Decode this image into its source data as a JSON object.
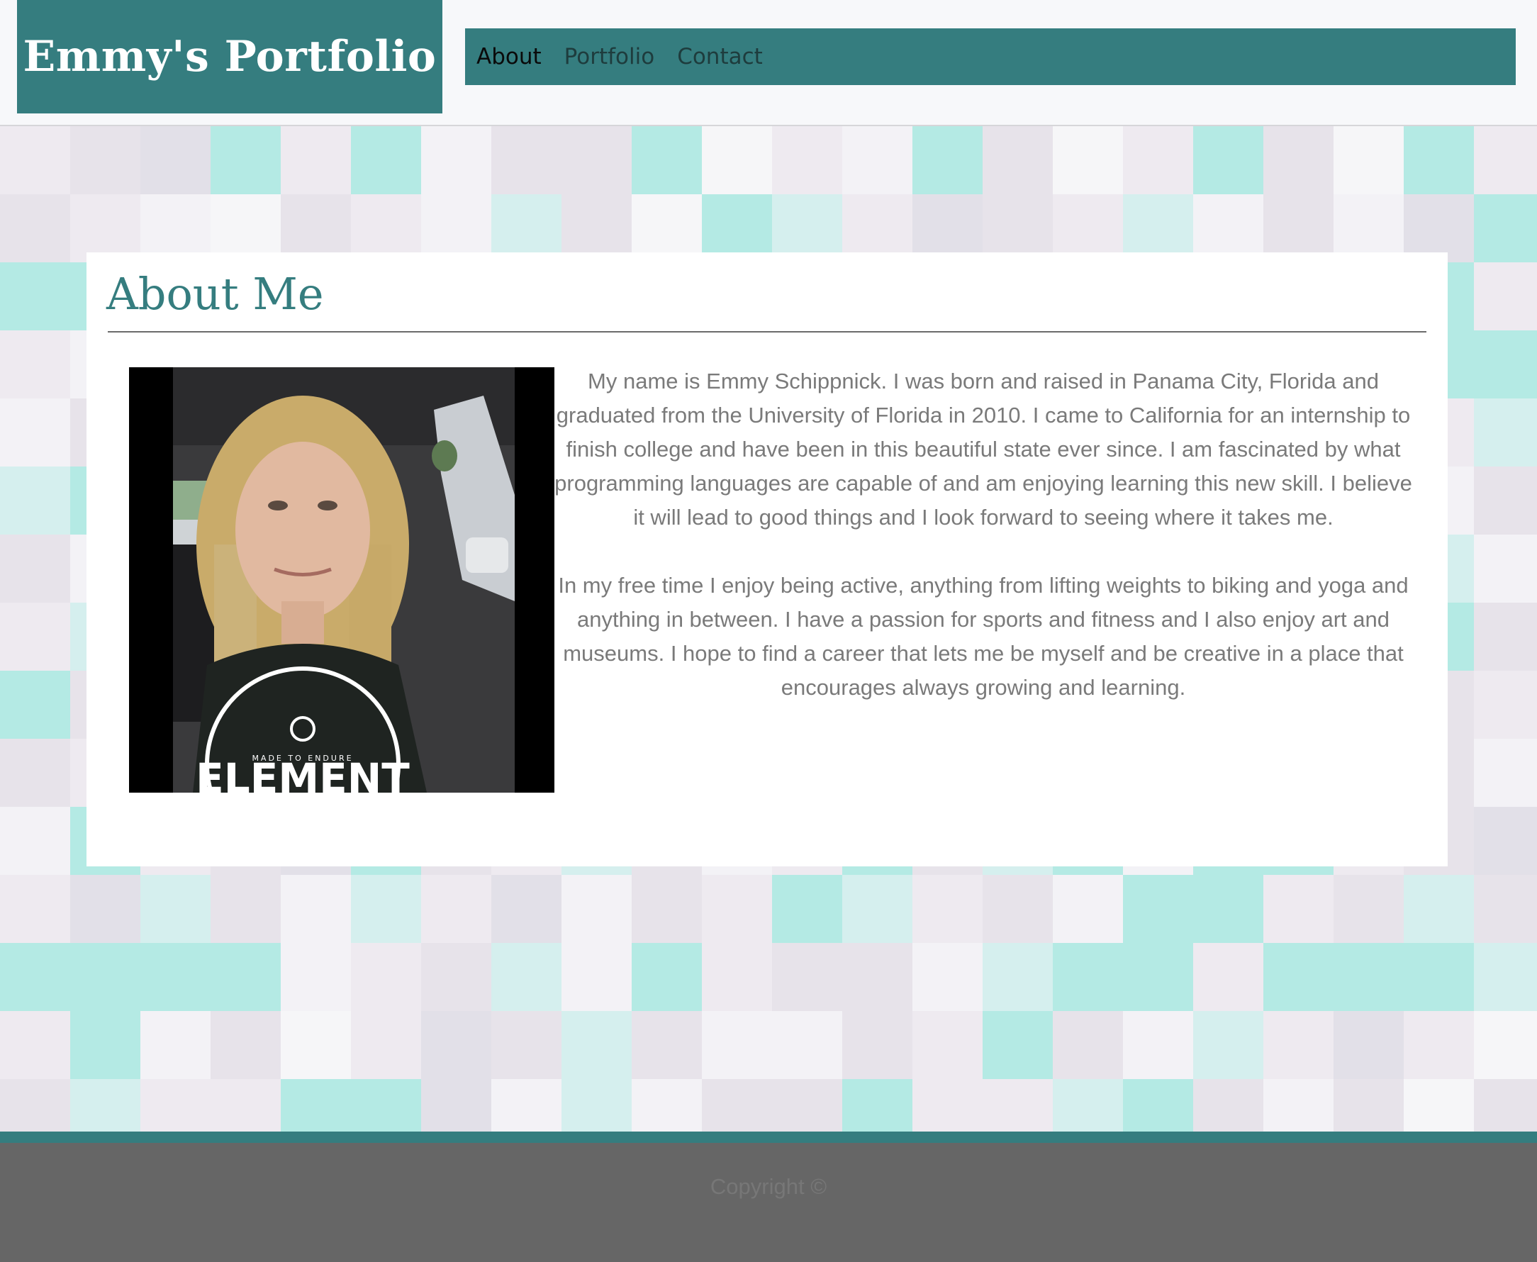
{
  "header": {
    "brand": "Emmy's Portfolio",
    "nav": [
      {
        "label": "About",
        "active": true
      },
      {
        "label": "Portfolio",
        "active": false
      },
      {
        "label": "Contact",
        "active": false
      }
    ]
  },
  "about": {
    "heading": "About Me",
    "paragraphs": [
      "My name is Emmy Schippnick. I was born and raised in Panama City, Florida and graduated from the University of Florida in 2010. I came to California for an internship to finish college and have been in this beautiful state ever since. I am fascinated by what programming languages are capable of and am enjoying learning this new skill. I believe it will lead to good things and I look forward to seeing where it takes me.",
      "In my free time I enjoy being active, anything from lifting weights to biking and yoga and anything in between. I have a passion for sports and fitness and I also enjoy art and museums. I hope to find a career that lets me be myself and be creative in a place that encourages always growing and learning."
    ],
    "photo_shirt_text": "ELEMENT",
    "photo_shirt_small": "MADE TO ENDURE"
  },
  "footer": {
    "copyright": "Copyright ©"
  },
  "colors": {
    "accent": "#357d7f",
    "text": "#7a7a7a",
    "footer": "#666666"
  }
}
